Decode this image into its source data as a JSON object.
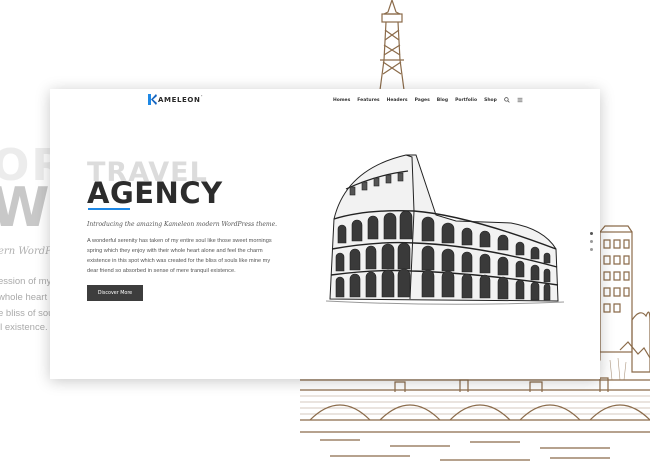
{
  "background": {
    "big_word_1": "OR",
    "big_word_2": "WO",
    "italic_line": "ern WordPre",
    "lines": [
      "ession of my",
      "whole heart",
      "e bliss of sou",
      "il existence."
    ]
  },
  "nav": {
    "logo_text": "AMELEON",
    "logo_sup": "'",
    "items": [
      "Homes",
      "Features",
      "Headers",
      "Pages",
      "Blog",
      "Portfolio",
      "Shop"
    ],
    "icons": [
      "search-icon",
      "menu-icon"
    ]
  },
  "hero": {
    "title_back": "TRAVEL",
    "title_front": "AGENCY",
    "tagline": "Introducing the amazing Kameleon modern WordPress theme.",
    "description_lines": [
      "A wonderful serenity has taken of my entire soul like those sweet mornings",
      "spring which they enjoy with their whole heart alone and feel the charm",
      "existence in this spot which was created for the bliss of souls like mine my",
      "dear friend  so absorbed in sense of mere tranquil existence."
    ],
    "cta_label": "Discover More"
  },
  "colors": {
    "accent": "#1e88e5",
    "button": "#3d3d3d",
    "sketch": "#8b6b4a"
  }
}
